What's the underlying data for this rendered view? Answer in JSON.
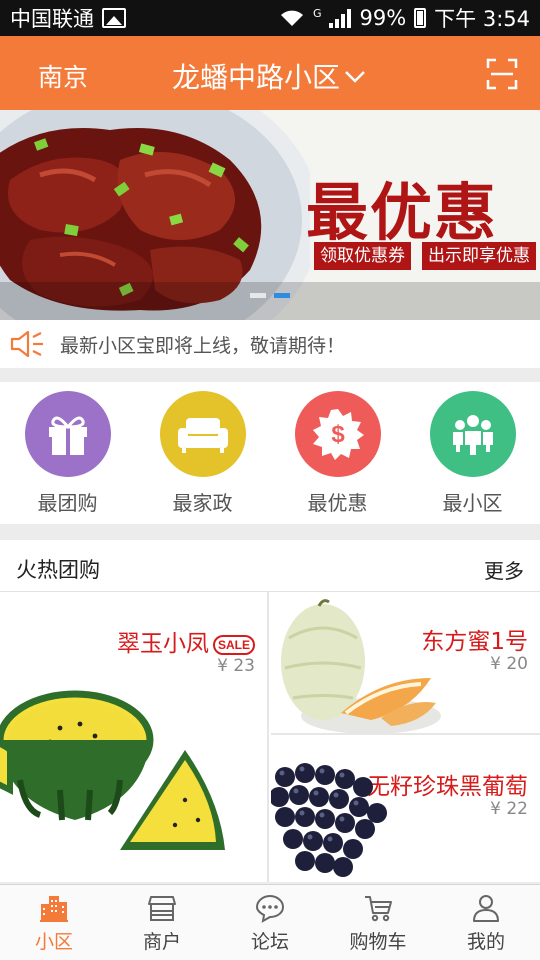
{
  "status_bar": {
    "carrier": "中国联通",
    "network": "G",
    "battery": "99%",
    "time": "下午 3:54"
  },
  "header": {
    "city": "南京",
    "community": "龙蟠中路小区",
    "scan_icon": "scan-icon"
  },
  "banner": {
    "slogan": "最优惠",
    "tag_coupon": "领取优惠券",
    "tag_show": "出示即享优惠",
    "slide_count": 2,
    "active_slide": 2
  },
  "notice": {
    "text": "最新小区宝即将上线，敬请期待！",
    "icon": "speaker-icon"
  },
  "categories": [
    {
      "label": "最团购",
      "icon": "gift-icon",
      "color": "#9b72c8"
    },
    {
      "label": "最家政",
      "icon": "sofa-icon",
      "color": "#e3c22a"
    },
    {
      "label": "最优惠",
      "icon": "coupon-icon",
      "color": "#ee5b59"
    },
    {
      "label": "最小区",
      "icon": "community-icon",
      "color": "#3fbf83"
    }
  ],
  "hot": {
    "title": "火热团购",
    "more": "更多",
    "products": [
      {
        "name": "翠玉小凤",
        "badge": "SALE",
        "price": "¥ 23"
      },
      {
        "name": "东方蜜1号",
        "price": "¥ 20"
      },
      {
        "name": "无籽珍珠黑葡萄",
        "price": "¥ 22"
      }
    ]
  },
  "bottom_nav": [
    {
      "label": "小区",
      "icon": "building-icon",
      "active": true
    },
    {
      "label": "商户",
      "icon": "store-icon",
      "active": false
    },
    {
      "label": "论坛",
      "icon": "chat-icon",
      "active": false
    },
    {
      "label": "购物车",
      "icon": "cart-icon",
      "active": false
    },
    {
      "label": "我的",
      "icon": "user-icon",
      "active": false
    }
  ],
  "colors": {
    "accent": "#f47a3a",
    "price_red": "#d71b1b",
    "banner_red": "#b01515"
  }
}
